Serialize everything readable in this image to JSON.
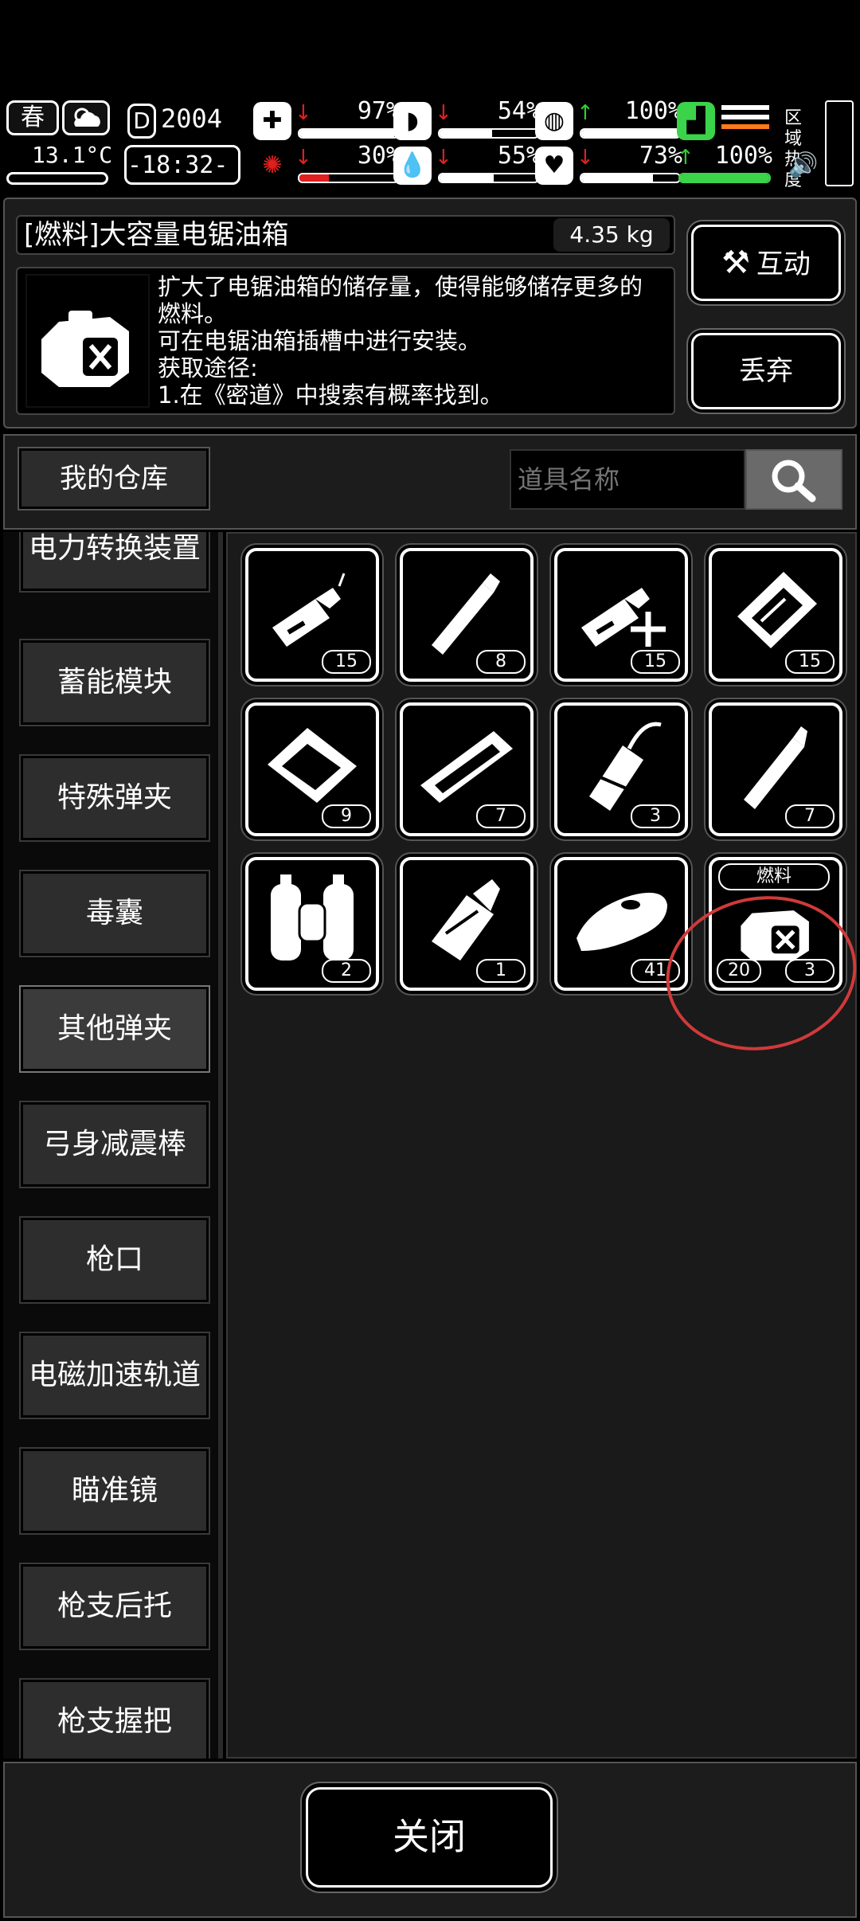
{
  "hud": {
    "season": "春",
    "temperature": "13.1°C",
    "day": "2004",
    "time": "-18:32-",
    "zone_label": "区域热度",
    "stats": [
      {
        "name": "health",
        "pct": "97%",
        "arrow": "down",
        "level": 0.97
      },
      {
        "name": "hunger",
        "pct": "54%",
        "arrow": "down",
        "level": 0.54
      },
      {
        "name": "energy",
        "pct": "100%",
        "arrow": "up",
        "level": 1.0
      },
      {
        "name": "stamina",
        "pct": "100%",
        "arrow": "up",
        "level": 1.0
      },
      {
        "name": "brain",
        "pct": "30%",
        "arrow": "down",
        "level": 0.3
      },
      {
        "name": "thirst",
        "pct": "55%",
        "arrow": "down",
        "level": 0.55
      },
      {
        "name": "mood",
        "pct": "73%",
        "arrow": "down",
        "level": 0.73
      },
      {
        "name": "leg",
        "pct": "100%",
        "arrow": "up",
        "level": 1.0
      }
    ]
  },
  "item": {
    "title": "[燃料]大容量电锯油箱",
    "weight": "4.35 kg",
    "description": [
      "扩大了电锯油箱的储存量，使得能够储存更多的",
      "燃料。",
      "可在电锯油箱插槽中进行安装。",
      "获取途径:",
      "1.在《密道》中搜索有概率找到。"
    ]
  },
  "buttons": {
    "interact": "互动",
    "discard": "丢弃",
    "close": "关闭"
  },
  "warehouse": {
    "tab": "我的仓库",
    "search_placeholder": "道具名称"
  },
  "categories": [
    "电力转换装置",
    "蓄能模块",
    "特殊弹夹",
    "毒囊",
    "其他弹夹",
    "弓身减震棒",
    "枪口",
    "电磁加速轨道",
    "瞄准镜",
    "枪支后托",
    "枪支握把"
  ],
  "active_category": "其他弹夹",
  "grid": [
    {
      "icon": "lighter-fluid-icon",
      "qty": "15"
    },
    {
      "icon": "gas-canister-icon",
      "qty": "8"
    },
    {
      "icon": "lighter-fluid-plus-icon",
      "qty": "15"
    },
    {
      "icon": "fuel-pouch-icon",
      "qty": "15"
    },
    {
      "icon": "fuel-pack-icon",
      "qty": "9"
    },
    {
      "icon": "fuel-rail-icon",
      "qty": "7"
    },
    {
      "icon": "fuel-bottle-hose-icon",
      "qty": "3"
    },
    {
      "icon": "gas-cartridge-icon",
      "qty": "7"
    },
    {
      "icon": "twin-tanks-icon",
      "qty": "2"
    },
    {
      "icon": "fuel-bottle-icon",
      "qty": "1"
    },
    {
      "icon": "fuel-tank-icon",
      "qty": "41"
    },
    {
      "icon": "chainsaw-tank-icon",
      "qty": "3",
      "qty_left": "20",
      "tag": "燃料",
      "selected": true
    }
  ]
}
